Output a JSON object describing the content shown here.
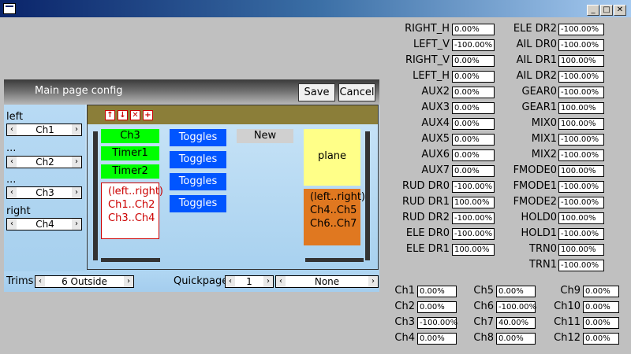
{
  "panel": {
    "title": "Main page config",
    "save_label": "Save",
    "cancel_label": "Cancel"
  },
  "sidebar": {
    "groups": [
      {
        "label": "left",
        "value": "Ch1"
      },
      {
        "label": "...",
        "value": "Ch2"
      },
      {
        "label": "...",
        "value": "Ch3"
      },
      {
        "label": "right",
        "value": "Ch4"
      }
    ]
  },
  "layout": {
    "left_cells": [
      "Ch3",
      "Timer1",
      "Timer2"
    ],
    "left_box": [
      "(left..right)",
      "Ch1..Ch2",
      "Ch3..Ch4"
    ],
    "toggles": [
      "Toggles",
      "Toggles",
      "Toggles",
      "Toggles"
    ],
    "new_label": "New",
    "plane_label": "plane",
    "right_box": [
      "(left..right)",
      "Ch4..Ch5",
      "Ch6..Ch7"
    ]
  },
  "bottom": {
    "trims_label": "Trims",
    "trims_value": "6 Outside",
    "quickpages_label": "Quickpages",
    "quickpages_value": "1",
    "quickpages_select": "None"
  },
  "inputs_col1": [
    {
      "label": "RIGHT_H",
      "value": "0.00%"
    },
    {
      "label": "LEFT_V",
      "value": "-100.00%"
    },
    {
      "label": "RIGHT_V",
      "value": "0.00%"
    },
    {
      "label": "LEFT_H",
      "value": "0.00%"
    },
    {
      "label": "AUX2",
      "value": "0.00%"
    },
    {
      "label": "AUX3",
      "value": "0.00%"
    },
    {
      "label": "AUX4",
      "value": "0.00%"
    },
    {
      "label": "AUX5",
      "value": "0.00%"
    },
    {
      "label": "AUX6",
      "value": "0.00%"
    },
    {
      "label": "AUX7",
      "value": "0.00%"
    },
    {
      "label": "RUD DR0",
      "value": "-100.00%"
    },
    {
      "label": "RUD DR1",
      "value": "100.00%"
    },
    {
      "label": "RUD DR2",
      "value": "-100.00%"
    },
    {
      "label": "ELE DR0",
      "value": "-100.00%"
    },
    {
      "label": "ELE DR1",
      "value": "100.00%"
    }
  ],
  "inputs_col2": [
    {
      "label": "ELE DR2",
      "value": "-100.00%"
    },
    {
      "label": "AIL DR0",
      "value": "-100.00%"
    },
    {
      "label": "AIL DR1",
      "value": "100.00%"
    },
    {
      "label": "AIL DR2",
      "value": "-100.00%"
    },
    {
      "label": "GEAR0",
      "value": "-100.00%"
    },
    {
      "label": "GEAR1",
      "value": "100.00%"
    },
    {
      "label": "MIX0",
      "value": "100.00%"
    },
    {
      "label": "MIX1",
      "value": "-100.00%"
    },
    {
      "label": "MIX2",
      "value": "-100.00%"
    },
    {
      "label": "FMODE0",
      "value": "100.00%"
    },
    {
      "label": "FMODE1",
      "value": "-100.00%"
    },
    {
      "label": "FMODE2",
      "value": "-100.00%"
    },
    {
      "label": "HOLD0",
      "value": "100.00%"
    },
    {
      "label": "HOLD1",
      "value": "-100.00%"
    },
    {
      "label": "TRN0",
      "value": "100.00%"
    },
    {
      "label": "TRN1",
      "value": "-100.00%"
    }
  ],
  "channels": [
    {
      "label": "Ch1",
      "value": "0.00%"
    },
    {
      "label": "Ch2",
      "value": "0.00%"
    },
    {
      "label": "Ch3",
      "value": "-100.00%"
    },
    {
      "label": "Ch4",
      "value": "0.00%"
    },
    {
      "label": "Ch5",
      "value": "0.00%"
    },
    {
      "label": "Ch6",
      "value": "-100.00%"
    },
    {
      "label": "Ch7",
      "value": "40.00%"
    },
    {
      "label": "Ch8",
      "value": "0.00%"
    },
    {
      "label": "Ch9",
      "value": "0.00%"
    },
    {
      "label": "Ch10",
      "value": "0.00%"
    },
    {
      "label": "Ch11",
      "value": "0.00%"
    },
    {
      "label": "Ch12",
      "value": "0.00%"
    }
  ],
  "icons": {
    "window_minimize": "minimize-icon",
    "window_maximize": "maximize-icon",
    "window_close": "close-icon",
    "tool_up": "move-up-icon",
    "tool_down": "move-down-icon",
    "tool_delete": "delete-icon",
    "tool_add": "add-icon"
  },
  "colors": {
    "toolbar": "#8b7e39",
    "green_cell": "#00ff00",
    "toggle_cell": "#0055ff",
    "plane_cell": "#ffff88",
    "orange_box": "#e07820"
  }
}
